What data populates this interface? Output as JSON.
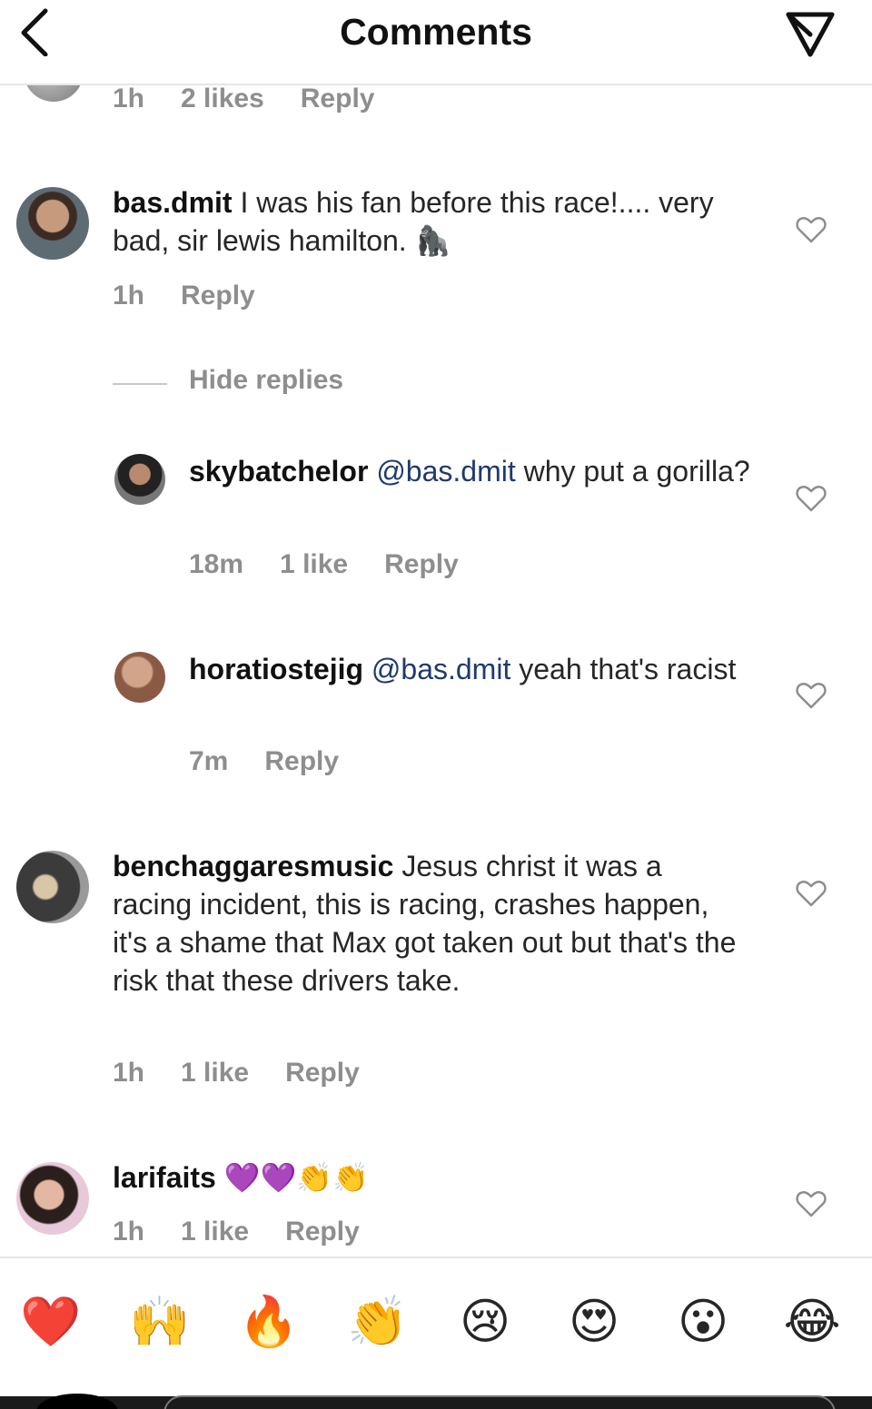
{
  "header": {
    "title": "Comments",
    "back_icon": "chevron-left-icon",
    "send_icon": "send-icon"
  },
  "partial_comment": {
    "time": "1h",
    "likes": "2 likes",
    "reply": "Reply"
  },
  "comments": [
    {
      "username": "bas.dmit",
      "text": "I was his fan before this race!.... very bad, sir lewis hamilton.",
      "emoji": "🦍",
      "time": "1h",
      "reply": "Reply"
    },
    {
      "username": "benchaggaresmusic",
      "text": "Jesus christ it was a racing incident, this is racing, crashes happen, it's a shame that Max got taken out but that's the risk that these drivers take.",
      "time": "1h",
      "likes": "1 like",
      "reply": "Reply"
    },
    {
      "username": "larifaits",
      "text": "💜💜👏👏",
      "time": "1h",
      "likes": "1 like",
      "reply": "Reply"
    }
  ],
  "hide_replies": "Hide replies",
  "replies": [
    {
      "username": "skybatchelor",
      "mention": "@bas.dmit",
      "text": "why put a gorilla?",
      "time": "18m",
      "likes": "1 like",
      "reply": "Reply"
    },
    {
      "username": "horatiostejig",
      "mention": "@bas.dmit",
      "text": "yeah that's racist",
      "time": "7m",
      "reply": "Reply"
    }
  ],
  "emoji_bar": [
    "❤️",
    "🙌",
    "🔥",
    "👏",
    "😢",
    "😍",
    "😮",
    "😂"
  ],
  "colors": {
    "meta_gray": "#8e8e8e",
    "mention_blue": "#1f3a6e",
    "divider": "#e6e6e6"
  }
}
